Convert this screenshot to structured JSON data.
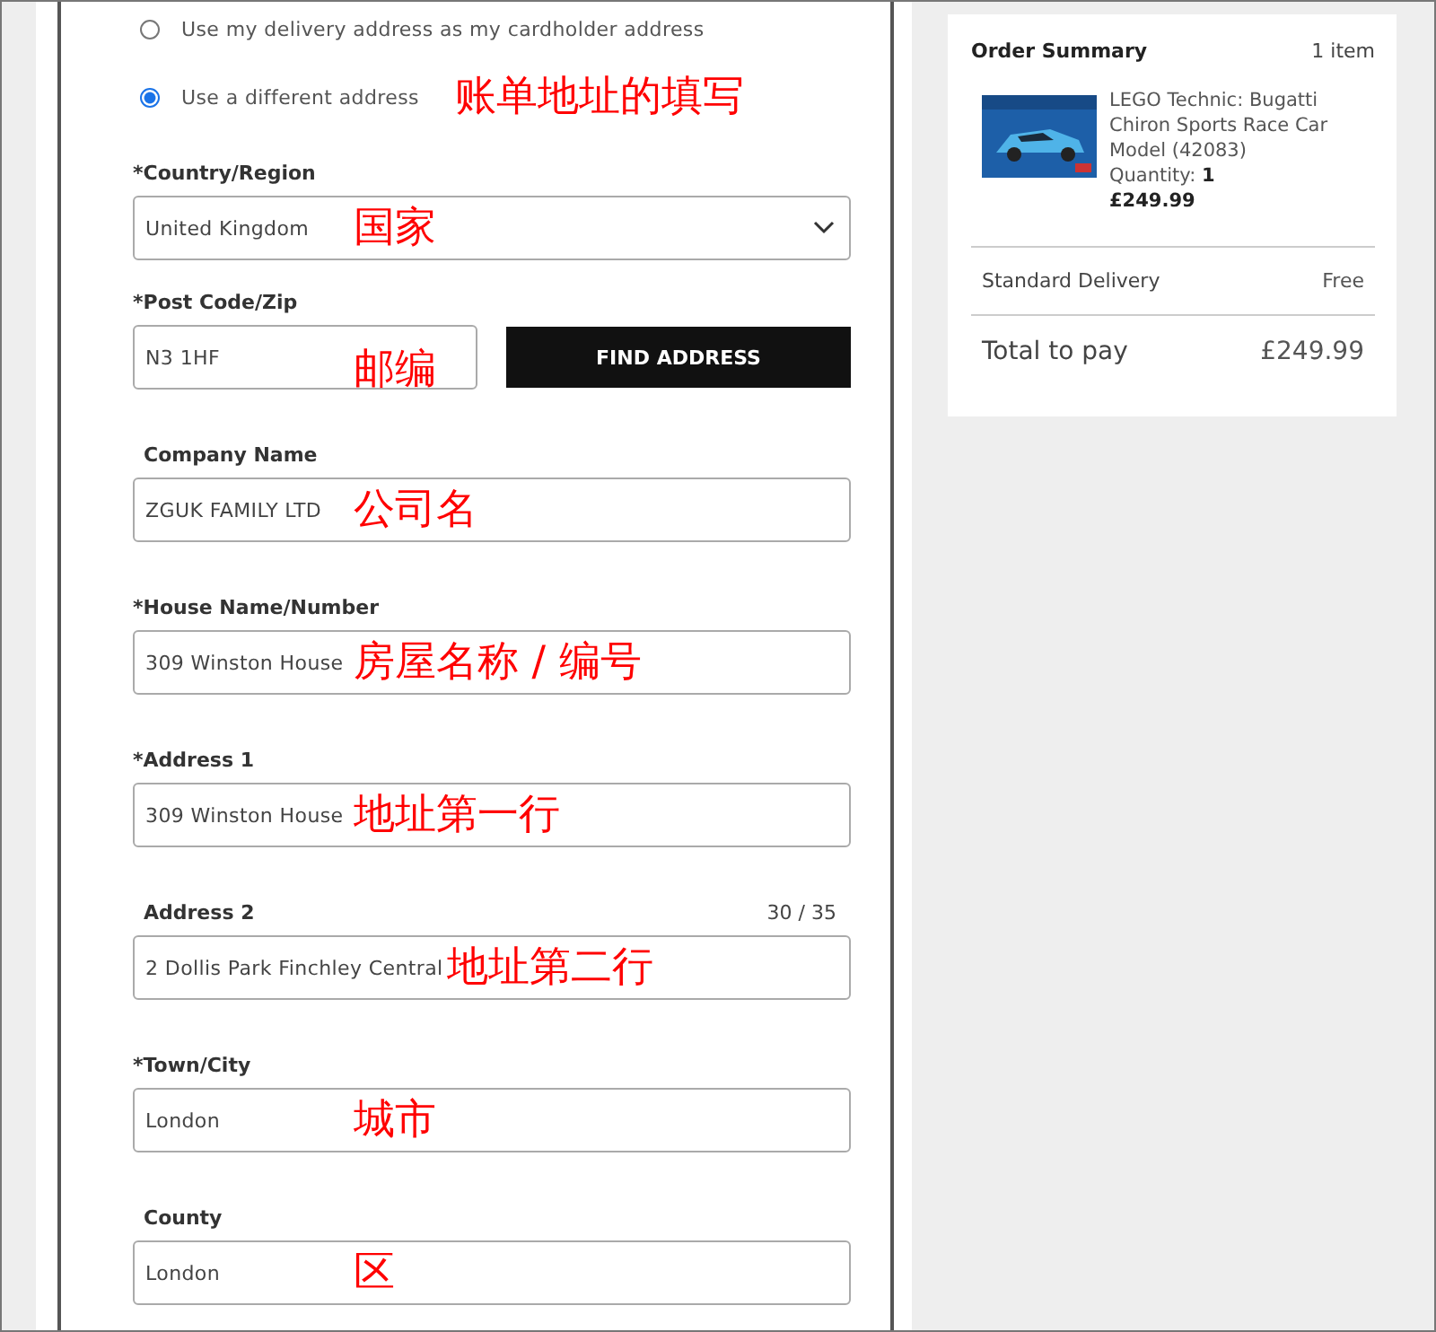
{
  "billing_options": [
    {
      "label": "Use my delivery address as my cardholder address",
      "selected": false
    },
    {
      "label": "Use a different address",
      "selected": true,
      "annotation": "账单地址的填写"
    }
  ],
  "fields": [
    {
      "kind": "select",
      "label": "*Country/Region",
      "value": "United Kingdom",
      "annotation": "国家"
    },
    {
      "kind": "postcode",
      "label": "*Post Code/Zip",
      "value": "N3 1HF",
      "annotation": "邮编",
      "button": "FIND ADDRESS"
    },
    {
      "kind": "text",
      "label": "Company Name",
      "value": "ZGUK FAMILY LTD",
      "annotation": "公司名"
    },
    {
      "kind": "text",
      "label": "*House Name/Number",
      "value": "309 Winston House",
      "annotation": "房屋名称 / 编号"
    },
    {
      "kind": "text",
      "label": "*Address 1",
      "value": "309 Winston House",
      "annotation": "地址第一行"
    },
    {
      "kind": "text",
      "label": "Address 2",
      "value": "2 Dollis Park Finchley Central",
      "annotation": "地址第二行",
      "counter": "30 / 35"
    },
    {
      "kind": "text",
      "label": "*Town/City",
      "value": "London",
      "annotation": "城市"
    },
    {
      "kind": "text",
      "label": "County",
      "value": "London",
      "annotation": "区"
    }
  ],
  "order_summary": {
    "title": "Order Summary",
    "count": "1 item",
    "product": {
      "name": "LEGO Technic: Bugatti Chiron Sports Race Car Model (42083)",
      "quantity_label": "Quantity:",
      "quantity": "1",
      "price": "£249.99"
    },
    "delivery": {
      "label": "Standard Delivery",
      "value": "Free"
    },
    "total": {
      "label": "Total to pay",
      "value": "£249.99"
    }
  }
}
